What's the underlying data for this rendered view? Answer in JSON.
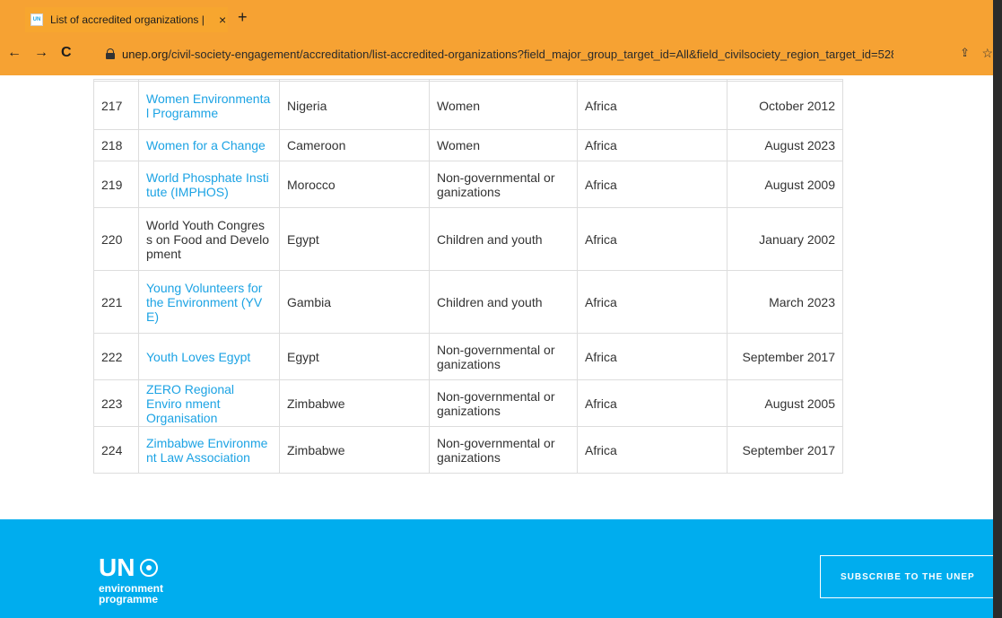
{
  "browser": {
    "tab_title": "List of accredited organizations |",
    "favicon_label": "UN",
    "close_glyph": "×",
    "new_tab_glyph": "+",
    "back_glyph": "←",
    "forward_glyph": "→",
    "reload_glyph": "C",
    "url_host": "unep.org",
    "url_path": "/civil-society-engagement/accreditation/list-accredited-organizations?field_major_group_target_id=All&field_civilsociety_region_target_id=528...",
    "share_glyph": "⇪",
    "star_glyph": "☆"
  },
  "table": {
    "rows": [
      {
        "num": "217",
        "org": "Women Environmenta l Programme",
        "org_link": true,
        "country": "Nigeria",
        "group": "Women",
        "region": "Africa",
        "date": "October 2012"
      },
      {
        "num": "218",
        "org": "Women for a Change",
        "org_link": true,
        "country": "Cameroon",
        "group": "Women",
        "region": "Africa",
        "date": "August 2023"
      },
      {
        "num": "219",
        "org": "World Phosphate Insti tute (IMPHOS)",
        "org_link": true,
        "country": "Morocco",
        "group": "Non-governmental or ganizations",
        "region": "Africa",
        "date": "August 2009"
      },
      {
        "num": "220",
        "org": "World Youth Congres s on Food and Develo pment",
        "org_link": false,
        "country": "Egypt",
        "group": "Children and youth",
        "region": "Africa",
        "date": "January 2002"
      },
      {
        "num": "221",
        "org": "Young Volunteers for the Environment (YV E)",
        "org_link": true,
        "country": "Gambia",
        "group": "Children and youth",
        "region": "Africa",
        "date": "March 2023"
      },
      {
        "num": "222",
        "org": "Youth Loves Egypt",
        "org_link": true,
        "country": "Egypt",
        "group": "Non-governmental or ganizations",
        "region": "Africa",
        "date": "September 2017"
      },
      {
        "num": "223",
        "org": "ZERO Regional Enviro nment Organisation",
        "org_link": true,
        "country": "Zimbabwe",
        "group": "Non-governmental or ganizations",
        "region": "Africa",
        "date": "August 2005"
      },
      {
        "num": "224",
        "org": "Zimbabwe Environme nt Law Association",
        "org_link": true,
        "country": "Zimbabwe",
        "group": "Non-governmental or ganizations",
        "region": "Africa",
        "date": "September 2017"
      }
    ]
  },
  "footer": {
    "logo_un": "UN",
    "logo_line1": "environment",
    "logo_line2": "programme",
    "subscribe_label": "SUBSCRIBE TO THE UNEP"
  },
  "colors": {
    "browser_chrome": "#f6a233",
    "link": "#1ca3e4",
    "footer": "#00adee"
  }
}
